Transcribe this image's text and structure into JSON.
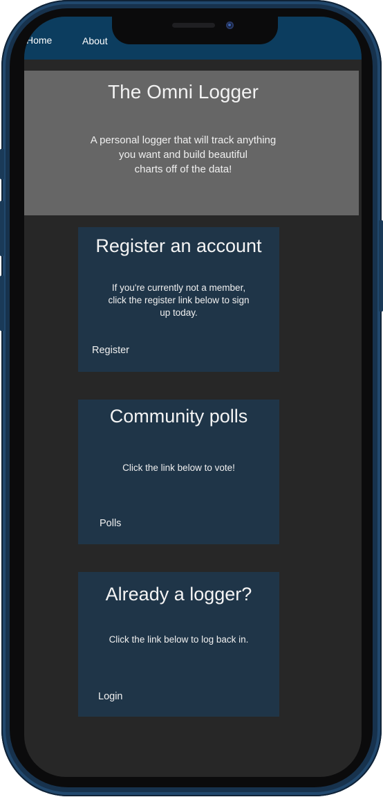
{
  "nav": {
    "home_label": "Home",
    "about_label": "About"
  },
  "hero": {
    "title": "The Omni Logger",
    "description": "A personal logger that will track anything\nyou want and build beautiful\n     charts off of the data!"
  },
  "cards": [
    {
      "title": "Register an account",
      "text": "If you're currently not a member,\nclick the register link below to sign\nup today.",
      "link": "Register"
    },
    {
      "title": "Community polls",
      "text": "Click the link below to vote!",
      "link": "Polls"
    },
    {
      "title": "Already a logger?",
      "text": "Click the link below to log back in.",
      "link": "Login"
    }
  ],
  "colors": {
    "navbar": "#0c3d5f",
    "page_background": "#272727",
    "hero_background": "#666666",
    "card_background": "#1f3548",
    "phone_frame": "#17324d"
  }
}
